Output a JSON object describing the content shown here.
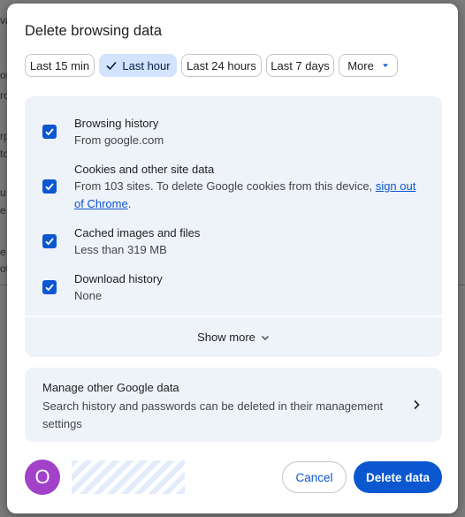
{
  "background_fragments": [
    "va",
    "or",
    "ro",
    "rp",
    "to",
    "u",
    "e",
    "e s",
    "ot"
  ],
  "dialog": {
    "title": "Delete browsing data",
    "time_ranges": [
      {
        "label": "Last 15 min",
        "selected": false
      },
      {
        "label": "Last hour",
        "selected": true
      },
      {
        "label": "Last 24 hours",
        "selected": false
      },
      {
        "label": "Last 7 days",
        "selected": false
      },
      {
        "label": "More",
        "selected": false
      }
    ],
    "items": [
      {
        "title": "Browsing history",
        "desc": "From google.com",
        "checked": true
      },
      {
        "title": "Cookies and other site data",
        "desc_prefix": "From 103 sites. To delete Google cookies from this device, ",
        "desc_link": "sign out of Chrome",
        "desc_suffix": ".",
        "checked": true
      },
      {
        "title": "Cached images and files",
        "desc": "Less than 319 MB",
        "checked": true
      },
      {
        "title": "Download history",
        "desc": "None",
        "checked": true
      }
    ],
    "show_more": "Show more",
    "manage": {
      "title": "Manage other Google data",
      "desc": "Search history and passwords can be deleted in their management settings"
    },
    "account": {
      "avatar_letter": "O"
    },
    "buttons": {
      "cancel": "Cancel",
      "delete": "Delete data"
    }
  },
  "colors": {
    "accent": "#0b57d0",
    "selected_chip": "#d3e3fd",
    "panel_bg": "#eef2f9",
    "avatar": "#a142c8"
  },
  "icons": {
    "checkbox": "checkbox-checked-icon",
    "chip_check": "checkmark-icon",
    "more_caret": "caret-down-icon",
    "show_more": "chevron-down-icon",
    "manage": "chevron-right-icon"
  }
}
